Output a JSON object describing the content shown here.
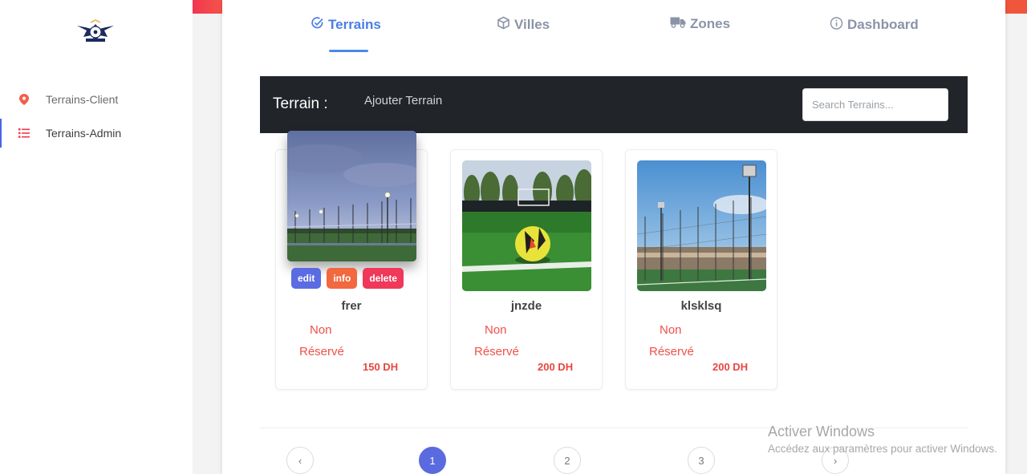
{
  "sidebar": {
    "items": [
      {
        "label": "Terrains-Client",
        "icon": "map-pin-icon"
      },
      {
        "label": "Terrains-Admin",
        "icon": "list-icon"
      }
    ]
  },
  "tabs": [
    {
      "label": "Terrains",
      "icon": "check-circle-icon",
      "active": true
    },
    {
      "label": "Villes",
      "icon": "box-icon"
    },
    {
      "label": "Zones",
      "icon": "truck-icon"
    },
    {
      "label": "Dashboard",
      "icon": "info-icon"
    }
  ],
  "toolbar": {
    "title": "Terrain :",
    "add_label": "Ajouter Terrain",
    "search_placeholder": "Search Terrains..."
  },
  "cards": [
    {
      "name": "frer",
      "status_line1": "Non",
      "status_line2": "Réservé",
      "price": "150 DH",
      "image": "stadium-evening-photo"
    },
    {
      "name": "jnzde",
      "status_line1": "Non",
      "status_line2": "Réservé",
      "price": "200 DH",
      "image": "soccer-ball-photo"
    },
    {
      "name": "klsklsq",
      "status_line1": "Non",
      "status_line2": "Réservé",
      "price": "200 DH",
      "image": "fenced-pitch-photo"
    }
  ],
  "card_actions": {
    "edit": "edit",
    "info": "info",
    "delete": "delete"
  },
  "pagination": {
    "prev": "‹",
    "pages": [
      "1",
      "2",
      "3"
    ],
    "next": "›",
    "current": "1"
  },
  "watermark": {
    "line1": "Activer Windows",
    "line2": "Accédez aux paramètres pour activer Windows."
  },
  "colors": {
    "accent": "#4a7ee7",
    "topbar": "#212529",
    "status": "#f0504a",
    "page_active": "#5a6be0"
  }
}
